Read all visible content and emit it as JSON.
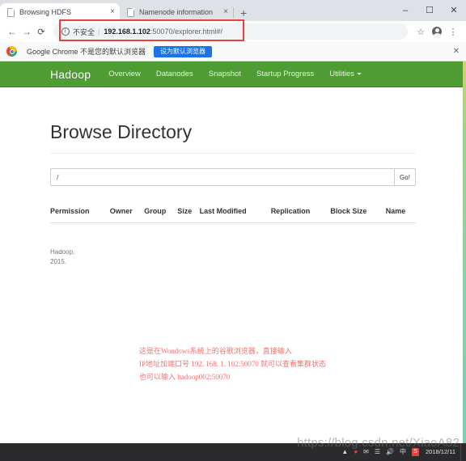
{
  "browser": {
    "tabs": [
      {
        "title": "Browsing HDFS",
        "active": true,
        "close_label": "×",
        "favicon": "page-icon"
      },
      {
        "title": "Namenode information",
        "active": false,
        "close_label": "×",
        "favicon": "page-icon"
      }
    ],
    "new_tab_label": "+",
    "window_controls": {
      "minimize": "–",
      "maximize": "☐",
      "close": "✕"
    },
    "toolbar": {
      "back_label": "←",
      "forward_label": "→",
      "reload_label": "⟳",
      "security_text": "不安全",
      "separator": "|",
      "url_host": "192.168.1.102",
      "url_rest": ":50070/explorer.html#/",
      "bookmark_label": "☆",
      "menu_label": "⋮"
    },
    "infobar": {
      "message": "Google Chrome 不是您的默认浏览器",
      "button_label": "设为默认浏览器",
      "close_label": "✕"
    }
  },
  "navbar": {
    "brand": "Hadoop",
    "links": [
      {
        "label": "Overview"
      },
      {
        "label": "Datanodes"
      },
      {
        "label": "Snapshot"
      },
      {
        "label": "Startup Progress"
      },
      {
        "label": "Utilities",
        "has_caret": true
      }
    ],
    "background_color": "#4f9b34"
  },
  "main": {
    "title": "Browse Directory",
    "search": {
      "value": "/",
      "placeholder": ""
    },
    "go_button": "Go!",
    "table": {
      "columns": [
        "Permission",
        "Owner",
        "Group",
        "Size",
        "Last Modified",
        "Replication",
        "Block Size",
        "Name"
      ],
      "rows": []
    },
    "footer_lines": [
      "Hadoop,",
      "2015."
    ]
  },
  "annotation": {
    "color": "#f4716f",
    "lines": [
      "这是在Wondows系统上的谷歌浏览器，直接输入",
      "IP地址加端口号  192. 168. 1. 102:50070  就可以查看集群状态",
      "也可以输入 hadoop002:50070"
    ]
  },
  "watermark": "https://blog.csdn.net/XiaoA82",
  "taskbar": {
    "tray_icons": [
      "pin-icon",
      "penguin-icon",
      "mail-icon",
      "network-icon",
      "volume-icon",
      "ime-icon",
      "powerpoint-icon"
    ],
    "ime_label": "中",
    "ppt_label": "S",
    "clock": "2018/12/11"
  }
}
